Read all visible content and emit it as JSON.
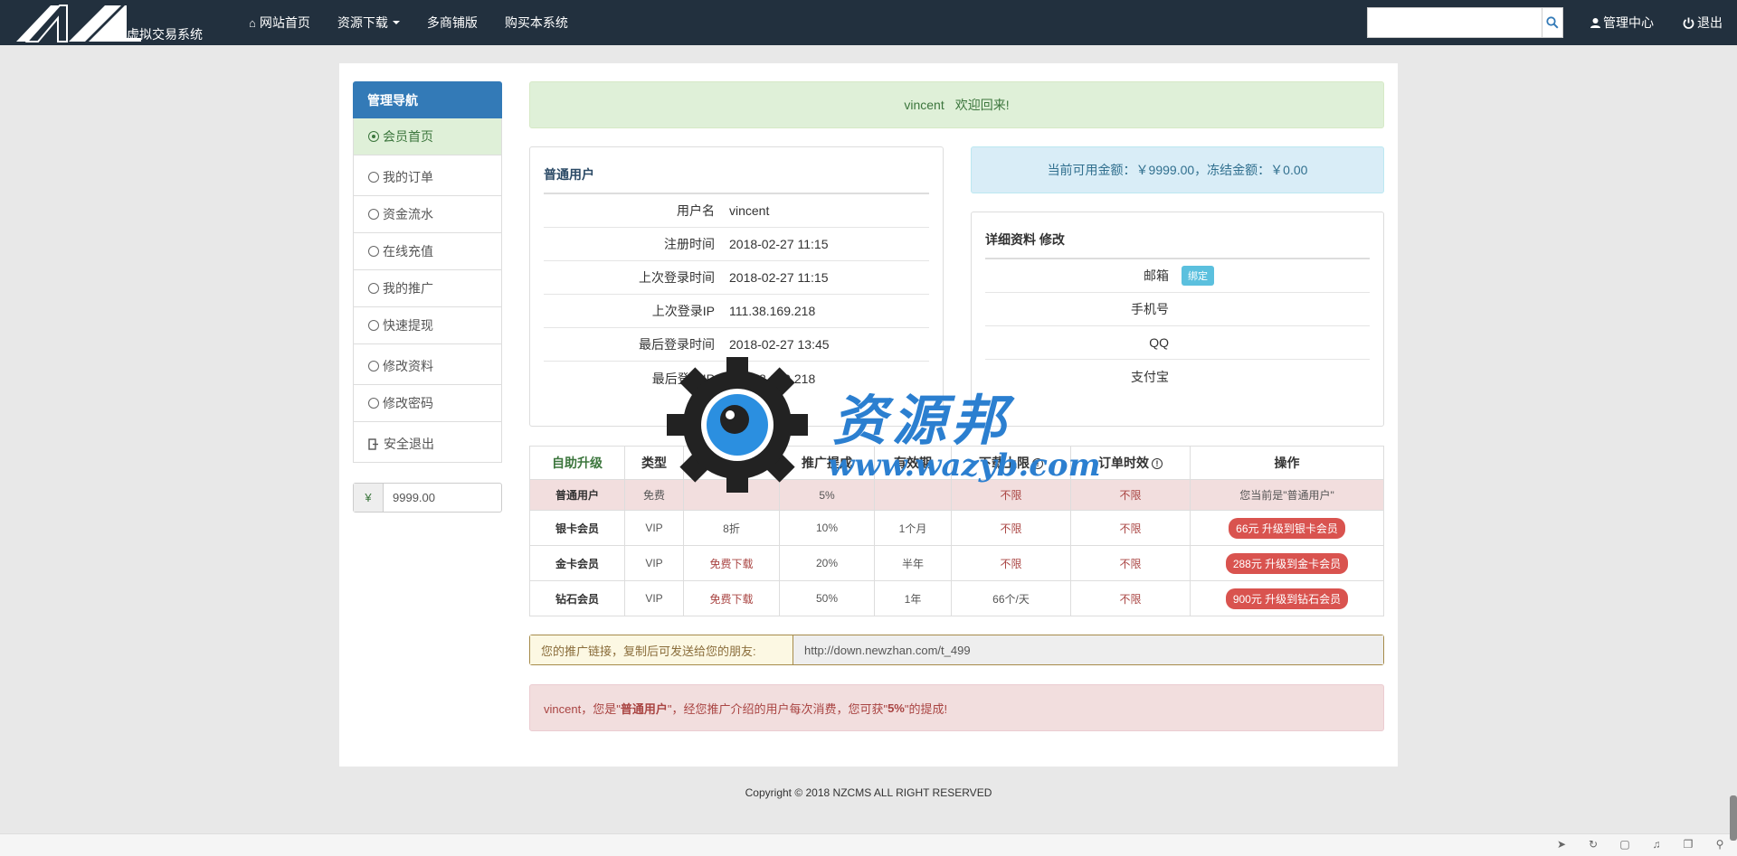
{
  "navbar": {
    "brand": "虚拟交易系统",
    "links": [
      {
        "label": "网站首页",
        "icon": "home-icon"
      },
      {
        "label": "资源下载",
        "icon": ""
      },
      {
        "label": "多商铺版",
        "icon": ""
      },
      {
        "label": "购买本系统",
        "icon": ""
      }
    ],
    "search_placeholder": "",
    "user_center": "管理中心",
    "logout": "退出"
  },
  "sidebar": {
    "title": "管理导航",
    "items": [
      {
        "label": "会员首页",
        "active": true
      },
      {
        "label": "我的订单"
      },
      {
        "label": "资金流水"
      },
      {
        "label": "在线充值"
      },
      {
        "label": "我的推广"
      },
      {
        "label": "快速提现"
      },
      {
        "label": "修改资料"
      },
      {
        "label": "修改密码"
      },
      {
        "label": "安全退出"
      }
    ],
    "balance_symbol": "¥",
    "balance_value": "9999.00"
  },
  "welcome": {
    "username": "vincent",
    "text": "欢迎回来!"
  },
  "balance_info": "当前可用金额：￥9999.00，冻结金额：￥0.00",
  "account": {
    "title": "普通用户",
    "rows": [
      {
        "label": "用户名",
        "value": "vincent"
      },
      {
        "label": "注册时间",
        "value": "2018-02-27 11:15"
      },
      {
        "label": "上次登录时间",
        "value": "2018-02-27 11:15"
      },
      {
        "label": "上次登录IP",
        "value": "111.38.169.218"
      },
      {
        "label": "最后登录时间",
        "value": "2018-02-27 13:45"
      },
      {
        "label": "最后登录IP",
        "value": "111.38.169.218"
      }
    ]
  },
  "details": {
    "title": "详细资料 修改",
    "rows": [
      {
        "label": "邮箱",
        "badge": "绑定"
      },
      {
        "label": "手机号"
      },
      {
        "label": "QQ"
      },
      {
        "label": "支付宝"
      }
    ]
  },
  "upgrade_table": {
    "headers": [
      "自助升级",
      "类型",
      "享受优惠",
      "推广提成",
      "有效期",
      "下载上限",
      "订单时效",
      "操作"
    ],
    "rows": [
      {
        "name": "普通用户",
        "type": "免费",
        "discount": "",
        "commission": "5%",
        "validity": "",
        "download": "不限",
        "order": "不限",
        "action": "您当前是\"普通用户\""
      },
      {
        "name": "银卡会员",
        "type": "VIP",
        "discount": "8折",
        "commission": "10%",
        "validity": "1个月",
        "download": "不限",
        "order": "不限",
        "action": "66元 升级到银卡会员"
      },
      {
        "name": "金卡会员",
        "type": "VIP",
        "discount": "免费下载",
        "commission": "20%",
        "validity": "半年",
        "download": "不限",
        "order": "不限",
        "action": "288元 升级到金卡会员"
      },
      {
        "name": "钻石会员",
        "type": "VIP",
        "discount": "免费下载",
        "commission": "50%",
        "validity": "1年",
        "download": "66个/天",
        "order": "不限",
        "action": "900元 升级到钻石会员"
      }
    ]
  },
  "promo": {
    "label": "您的推广链接，复制后可发送给您的朋友:",
    "url": "http://down.newzhan.com/t_499"
  },
  "commission_note": {
    "prefix": "vincent，您是\"",
    "level": "普通用户",
    "middle": "\"，经您推广介绍的用户每次消费，您可获\"",
    "rate": "5%",
    "suffix": "\"的提成!"
  },
  "footer": "Copyright © 2018 NZCMS ALL RIGHT RESERVED",
  "watermark": {
    "text": "资源邦",
    "url": "www.wazyb.com"
  }
}
